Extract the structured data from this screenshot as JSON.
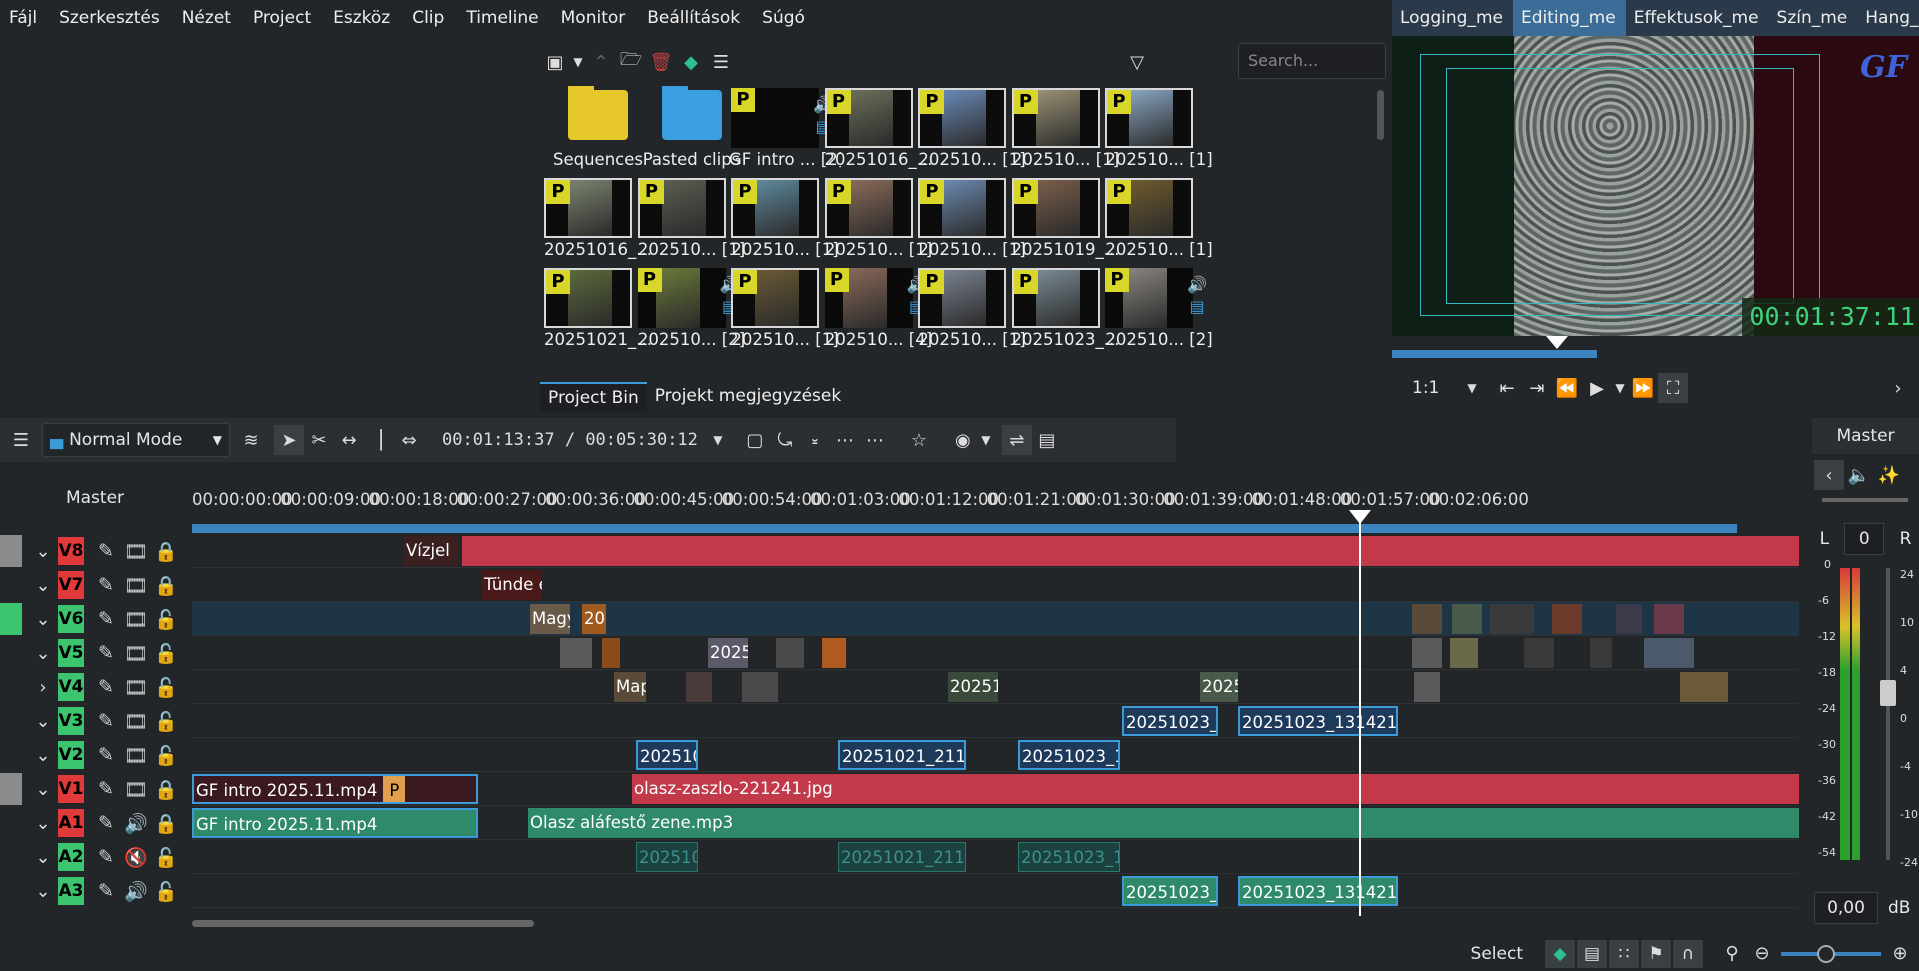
{
  "menubar": [
    "Fájl",
    "Szerkesztés",
    "Nézet",
    "Project",
    "Eszköz",
    "Clip",
    "Timeline",
    "Monitor",
    "Beállítások",
    "Súgó"
  ],
  "workspaces": [
    {
      "label": "Logging_me",
      "active": false
    },
    {
      "label": "Editing_me",
      "active": true
    },
    {
      "label": "Effektusok_me",
      "active": false
    },
    {
      "label": "Szín_me",
      "active": false
    },
    {
      "label": "Hang_me",
      "active": false
    }
  ],
  "bin": {
    "search_placeholder": "Search...",
    "tabs": [
      "Project Bin",
      "Projekt megjegyzések"
    ],
    "items": [
      {
        "label": "Sequences",
        "kind": "folder",
        "color": "#e6c72a"
      },
      {
        "label": "Pasted clips",
        "kind": "folder",
        "color": "#3a9ee0"
      },
      {
        "label": "GF intro ... [2]",
        "kind": "av"
      },
      {
        "label": "20251016_...",
        "kind": "img",
        "tone": "#6b6f5a"
      },
      {
        "label": "202510... [1]",
        "kind": "img",
        "tone": "#6a8ab8"
      },
      {
        "label": "202510... [1]",
        "kind": "img",
        "tone": "#9a9276"
      },
      {
        "label": "202510... [1]",
        "kind": "img",
        "tone": "#8aa6c2"
      },
      {
        "label": "20251016_...",
        "kind": "img",
        "tone": "#7c8470"
      },
      {
        "label": "202510... [1]",
        "kind": "img",
        "tone": "#5a5e52"
      },
      {
        "label": "202510... [1]",
        "kind": "img",
        "tone": "#5f8a9e"
      },
      {
        "label": "202510... [1]",
        "kind": "img",
        "tone": "#8a6b5a"
      },
      {
        "label": "202510... [1]",
        "kind": "img",
        "tone": "#6c8ab0"
      },
      {
        "label": "20251019_...",
        "kind": "img",
        "tone": "#7a5e4a"
      },
      {
        "label": "202510... [1]",
        "kind": "img",
        "tone": "#6e5a2e"
      },
      {
        "label": "20251021_...",
        "kind": "img",
        "tone": "#5b6a3c"
      },
      {
        "label": "202510... [2]",
        "kind": "av",
        "tone": "#6a7a3a"
      },
      {
        "label": "202510... [1]",
        "kind": "img",
        "tone": "#6a5a34"
      },
      {
        "label": "202510... [4]",
        "kind": "av",
        "tone": "#8a6a5a"
      },
      {
        "label": "202510... [1]",
        "kind": "img",
        "tone": "#7a8290"
      },
      {
        "label": "20251023_...",
        "kind": "img",
        "tone": "#7a8a94"
      },
      {
        "label": "202510... [2]",
        "kind": "av",
        "tone": "#8a8680"
      }
    ]
  },
  "monitor": {
    "timecode": "00:01:37:11",
    "zoom": "1:1",
    "logo": "GF",
    "progress": 0.39
  },
  "timeline": {
    "mode": "Normal Mode",
    "position": "00:01:13:37",
    "duration": "00:05:30:12",
    "master_label": "Master",
    "ruler": [
      "00:00:00:00",
      "00:00:09:00",
      "00:00:18:00",
      "00:00:27:00",
      "00:00:36:00",
      "00:00:45:00",
      "00:00:54:00",
      "00:01:03:00",
      "00:01:12:00",
      "00:01:21:00",
      "00:01:30:00",
      "00:01:39:00",
      "00:01:48:00",
      "00:01:57:00",
      "00:02:06:00"
    ],
    "tracks": [
      {
        "name": "V8",
        "tag_color": "#e03a3a",
        "side": "#8b8b8b",
        "kind": "video"
      },
      {
        "name": "V7",
        "tag_color": "#e03a3a",
        "side": "#232629",
        "kind": "video"
      },
      {
        "name": "V6",
        "tag_color": "#3cc46f",
        "side": "#3cc46f",
        "kind": "video"
      },
      {
        "name": "V5",
        "tag_color": "#3cc46f",
        "side": "#232629",
        "kind": "video"
      },
      {
        "name": "V4",
        "tag_color": "#3cc46f",
        "side": "#232629",
        "kind": "video"
      },
      {
        "name": "V3",
        "tag_color": "#3cc46f",
        "side": "#232629",
        "kind": "video"
      },
      {
        "name": "V2",
        "tag_color": "#3cc46f",
        "side": "#232629",
        "kind": "video"
      },
      {
        "name": "V1",
        "tag_color": "#e03a3a",
        "side": "#8b8b8b",
        "kind": "video"
      },
      {
        "name": "A1",
        "tag_color": "#e03a3a",
        "side": "#232629",
        "kind": "audio"
      },
      {
        "name": "A2",
        "tag_color": "#3cc46f",
        "side": "#232629",
        "kind": "audio",
        "muted": true
      },
      {
        "name": "A3",
        "tag_color": "#3cc46f",
        "side": "#232629",
        "kind": "audio"
      }
    ],
    "clip_labels": {
      "v8": "Vízjel",
      "v7": "Tünde é",
      "v1a": "GF intro 2025.11.mp4",
      "v1b": "olasz-zaszlo-221241.jpg",
      "a1a": "GF intro 2025.11.mp4",
      "a1b": "Olasz aláfestő zene.mp3",
      "v3a": "20251023_",
      "v3b": "20251023_131421-",
      "v2a": "202510",
      "v2b": "20251021_2116",
      "v2c": "20251023_1",
      "a2a": "202510",
      "a2b": "20251021_2116",
      "a2c": "20251023_1",
      "a3a": "20251023_",
      "a3b": "20251023_131421-",
      "v6a": "Magy",
      "v6b": "20",
      "v5a": "2025",
      "v4a": "Map",
      "v4b": "20251",
      "v4c": "2025",
      "v1badge": "P"
    }
  },
  "mixer": {
    "title": "Master",
    "balance": "0",
    "left": "L",
    "right": "R",
    "db_value": "0,00",
    "db_unit": "dB",
    "scale_left": [
      "0",
      "-6",
      "-12",
      "-18",
      "-24",
      "-30",
      "-36",
      "-42",
      "-54"
    ],
    "scale_right": [
      "24",
      "10",
      "4",
      "0",
      "-4",
      "-10",
      "-24"
    ]
  },
  "status": {
    "tool": "Select"
  }
}
